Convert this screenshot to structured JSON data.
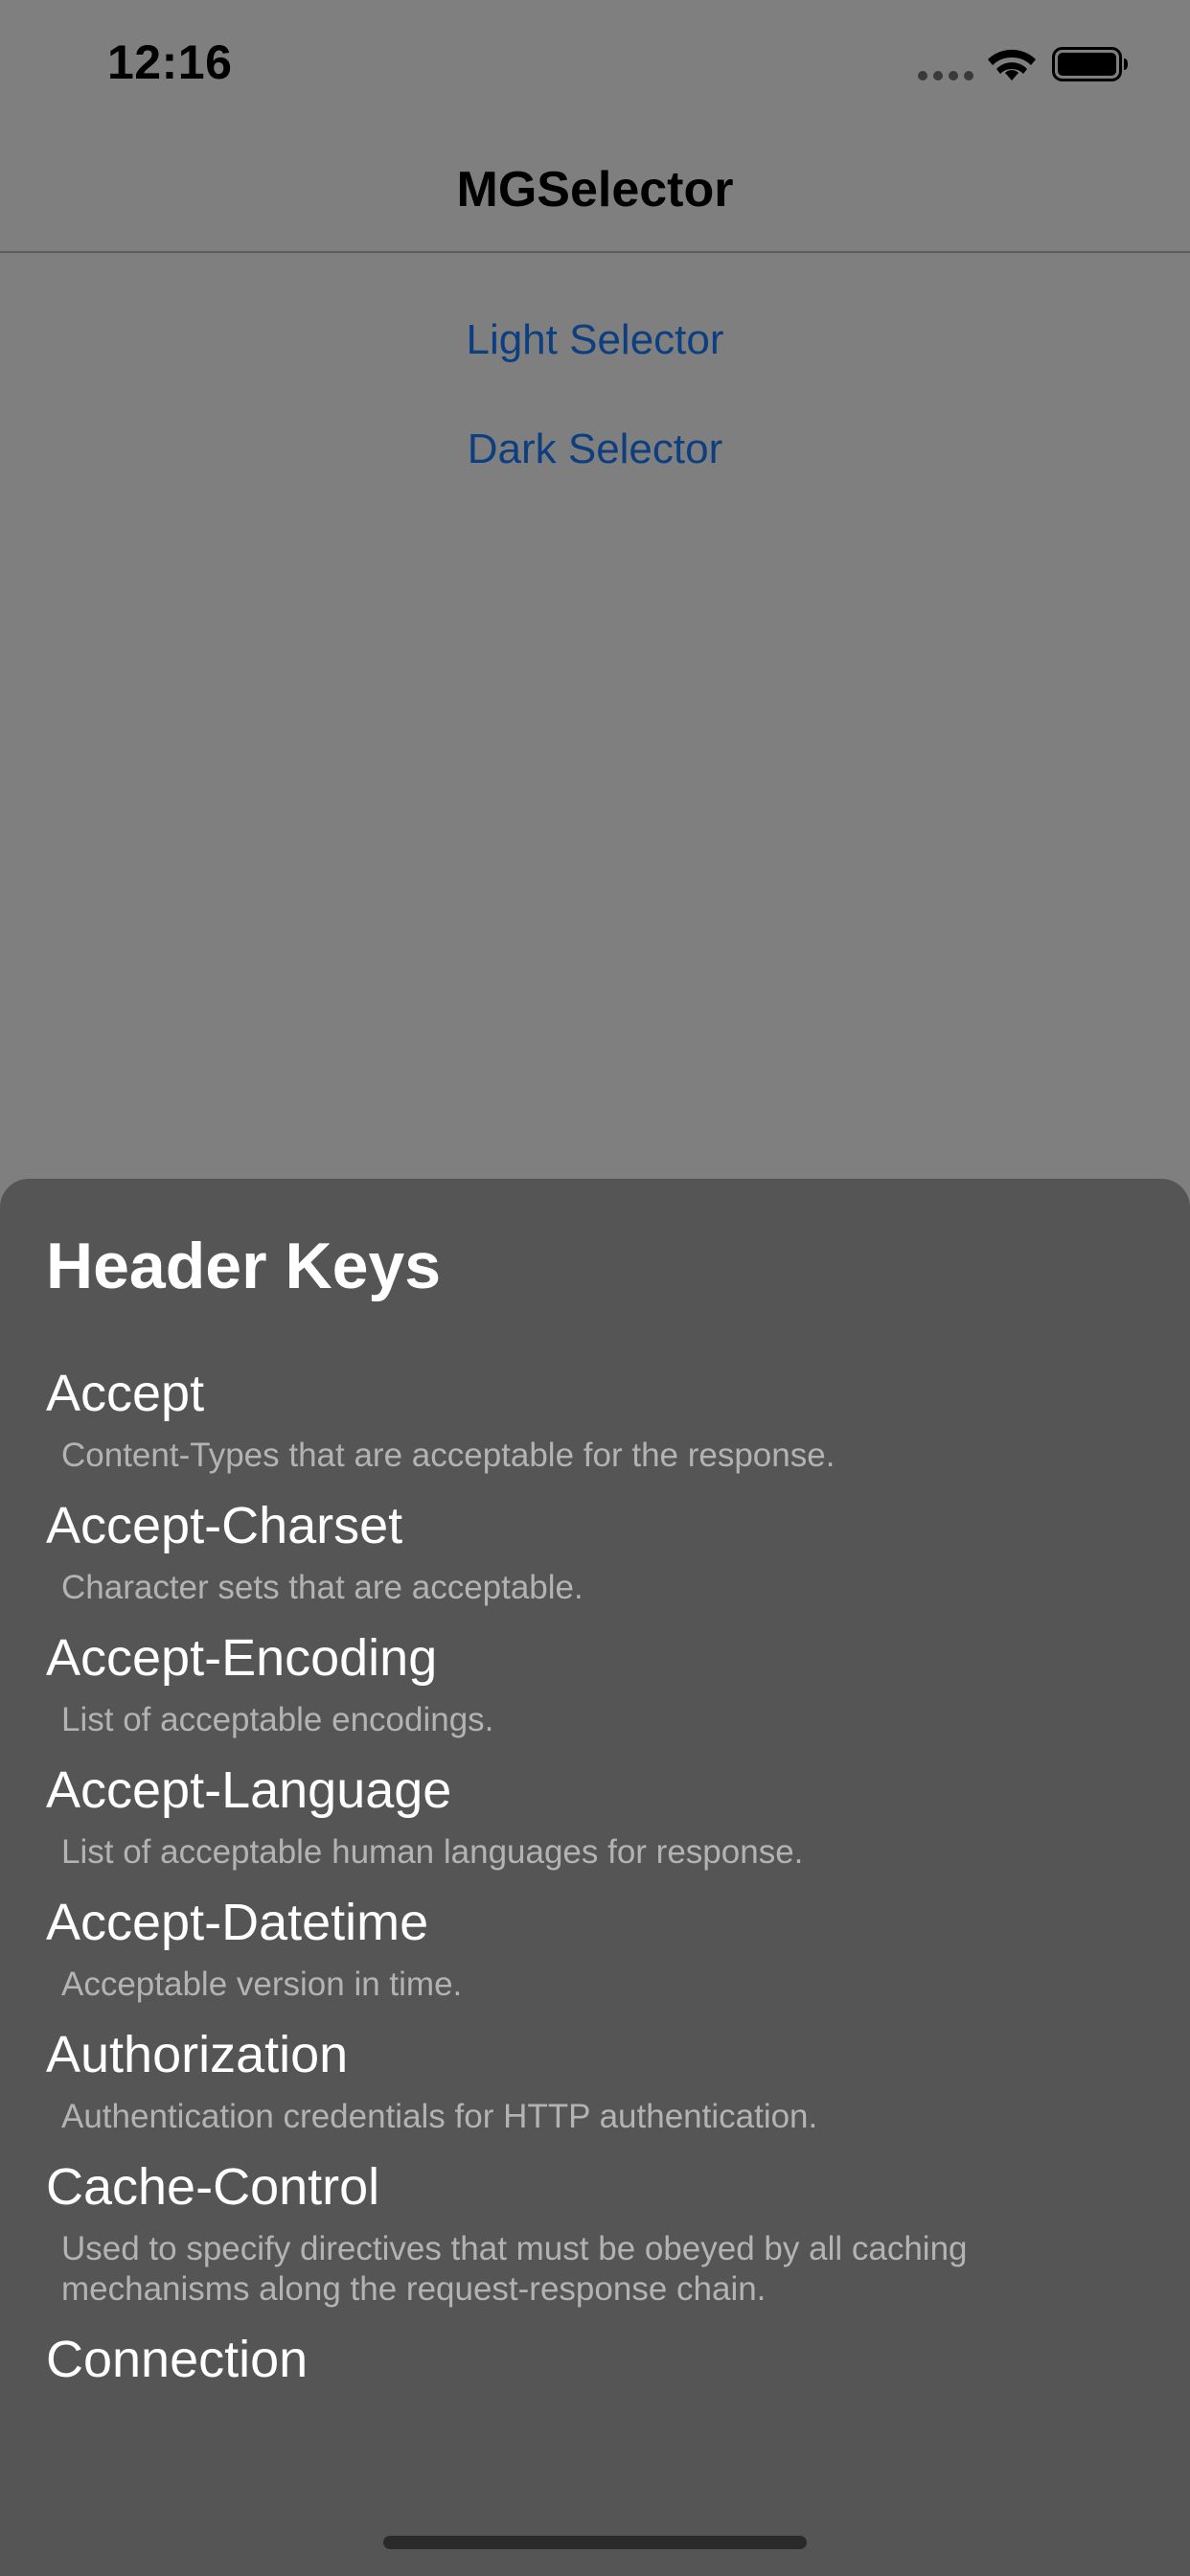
{
  "status_bar": {
    "time": "12:16"
  },
  "nav": {
    "title": "MGSelector"
  },
  "buttons": {
    "light": "Light Selector",
    "dark": "Dark Selector"
  },
  "colors": {
    "background": "#7f7f7f",
    "sheet": "#555555",
    "button_text": "#0d3f80"
  },
  "sheet": {
    "title": "Header Keys",
    "items": [
      {
        "name": "Accept",
        "description": "Content-Types that are acceptable for the response."
      },
      {
        "name": "Accept-Charset",
        "description": "Character sets that are acceptable."
      },
      {
        "name": "Accept-Encoding",
        "description": "List of acceptable encodings."
      },
      {
        "name": "Accept-Language",
        "description": "List of acceptable human languages for response."
      },
      {
        "name": "Accept-Datetime",
        "description": "Acceptable version in time."
      },
      {
        "name": "Authorization",
        "description": "Authentication credentials for HTTP authentication."
      },
      {
        "name": "Cache-Control",
        "description": "Used to specify directives that must be obeyed by all caching mechanisms along the request-response chain."
      },
      {
        "name": "Connection",
        "description": ""
      }
    ]
  },
  "icons": {
    "signal": "cellular-signal-icon",
    "wifi": "wifi-icon",
    "battery": "battery-icon"
  }
}
